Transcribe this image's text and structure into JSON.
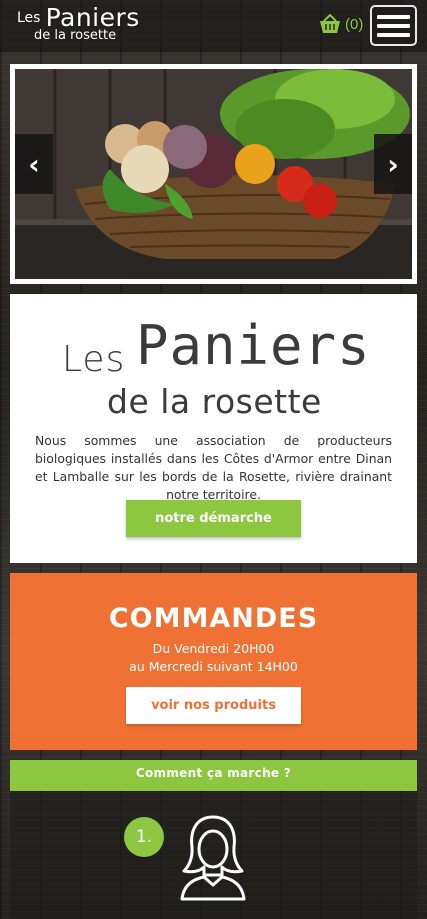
{
  "header": {
    "logo_les": "Les",
    "logo_paniers": "Paniers",
    "logo_rosette": "de la rosette",
    "cart_count": "(0)",
    "cart_icon": "basket-icon",
    "menu_icon": "hamburger-menu-icon"
  },
  "slider": {
    "prev_label": "‹",
    "next_label": "›"
  },
  "intro": {
    "logo_les": "Les",
    "logo_paniers": "Paniers",
    "logo_rosette": "de la rosette",
    "text": "Nous sommes une association de producteurs biologiques installés dans les Côtes d'Armor entre Dinan et Lamballe sur les bords de la Rosette, rivière drainant notre territoire.",
    "button": "notre démarche"
  },
  "orders": {
    "title": "COMMANDES",
    "line1": "Du Vendredi 20H00",
    "line2": "au Mercredi suivant 14H00",
    "button": "voir nos produits"
  },
  "how": {
    "title": "Comment ça marche ?",
    "step_number": "1.",
    "step_icon": "user-avatar-icon"
  },
  "colors": {
    "green": "#8dc63f",
    "orange": "#ef7134"
  }
}
